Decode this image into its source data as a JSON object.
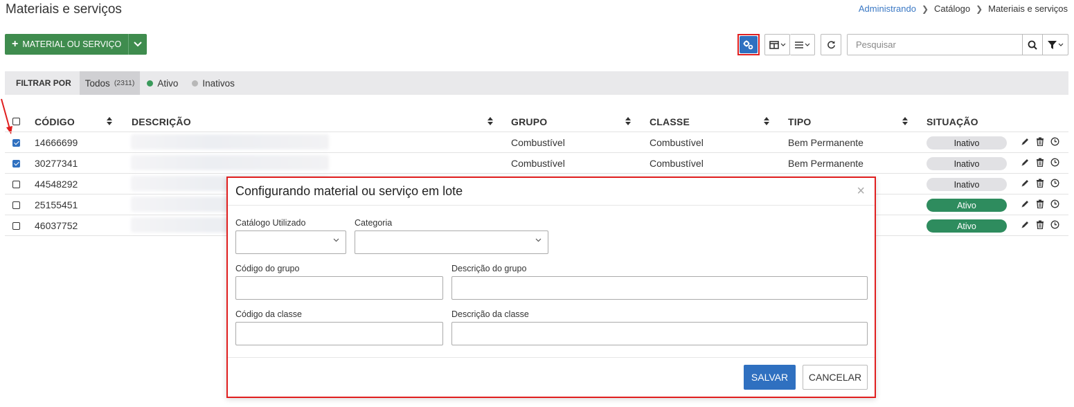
{
  "page": {
    "title": "Materiais e serviços"
  },
  "breadcrumb": {
    "items": [
      "Administrando",
      "Catálogo",
      "Materiais e serviços"
    ]
  },
  "toolbar": {
    "add_label": "MATERIAL OU SERVIÇO",
    "search_placeholder": "Pesquisar",
    "highlight_color": "#e01e1e",
    "primary_color": "#2f70c0"
  },
  "filter": {
    "label": "FILTRAR POR",
    "options": [
      {
        "label": "Todos",
        "count": "(2311)",
        "active": true
      },
      {
        "label": "Ativo",
        "dot": "#3a9a5b"
      },
      {
        "label": "Inativos",
        "dot": "#b8b8b8"
      }
    ]
  },
  "table": {
    "columns": [
      "CÓDIGO",
      "DESCRIÇÃO",
      "GRUPO",
      "CLASSE",
      "TIPO",
      "SITUAÇÃO"
    ],
    "rows": [
      {
        "checked": true,
        "code": "14666699",
        "group": "Combustível",
        "class": "Combustível",
        "type": "Bem Permanente",
        "status": "Inativo"
      },
      {
        "checked": true,
        "code": "30277341",
        "group": "Combustível",
        "class": "Combustível",
        "type": "Bem Permanente",
        "status": "Inativo"
      },
      {
        "checked": false,
        "code": "44548292",
        "group": "",
        "class": "",
        "type": "",
        "status": "Inativo"
      },
      {
        "checked": false,
        "code": "25155451",
        "group": "",
        "class": "",
        "type": "",
        "status": "Ativo"
      },
      {
        "checked": false,
        "code": "46037752",
        "group": "",
        "class": "",
        "type": "",
        "status": "Ativo"
      }
    ]
  },
  "modal": {
    "title": "Configurando material ou serviço em lote",
    "fields": {
      "catalog": "Catálogo Utilizado",
      "category": "Categoria",
      "group_code": "Código do grupo",
      "group_desc": "Descrição do grupo",
      "class_code": "Código da classe",
      "class_desc": "Descrição da classe"
    },
    "save": "SALVAR",
    "cancel": "CANCELAR"
  }
}
